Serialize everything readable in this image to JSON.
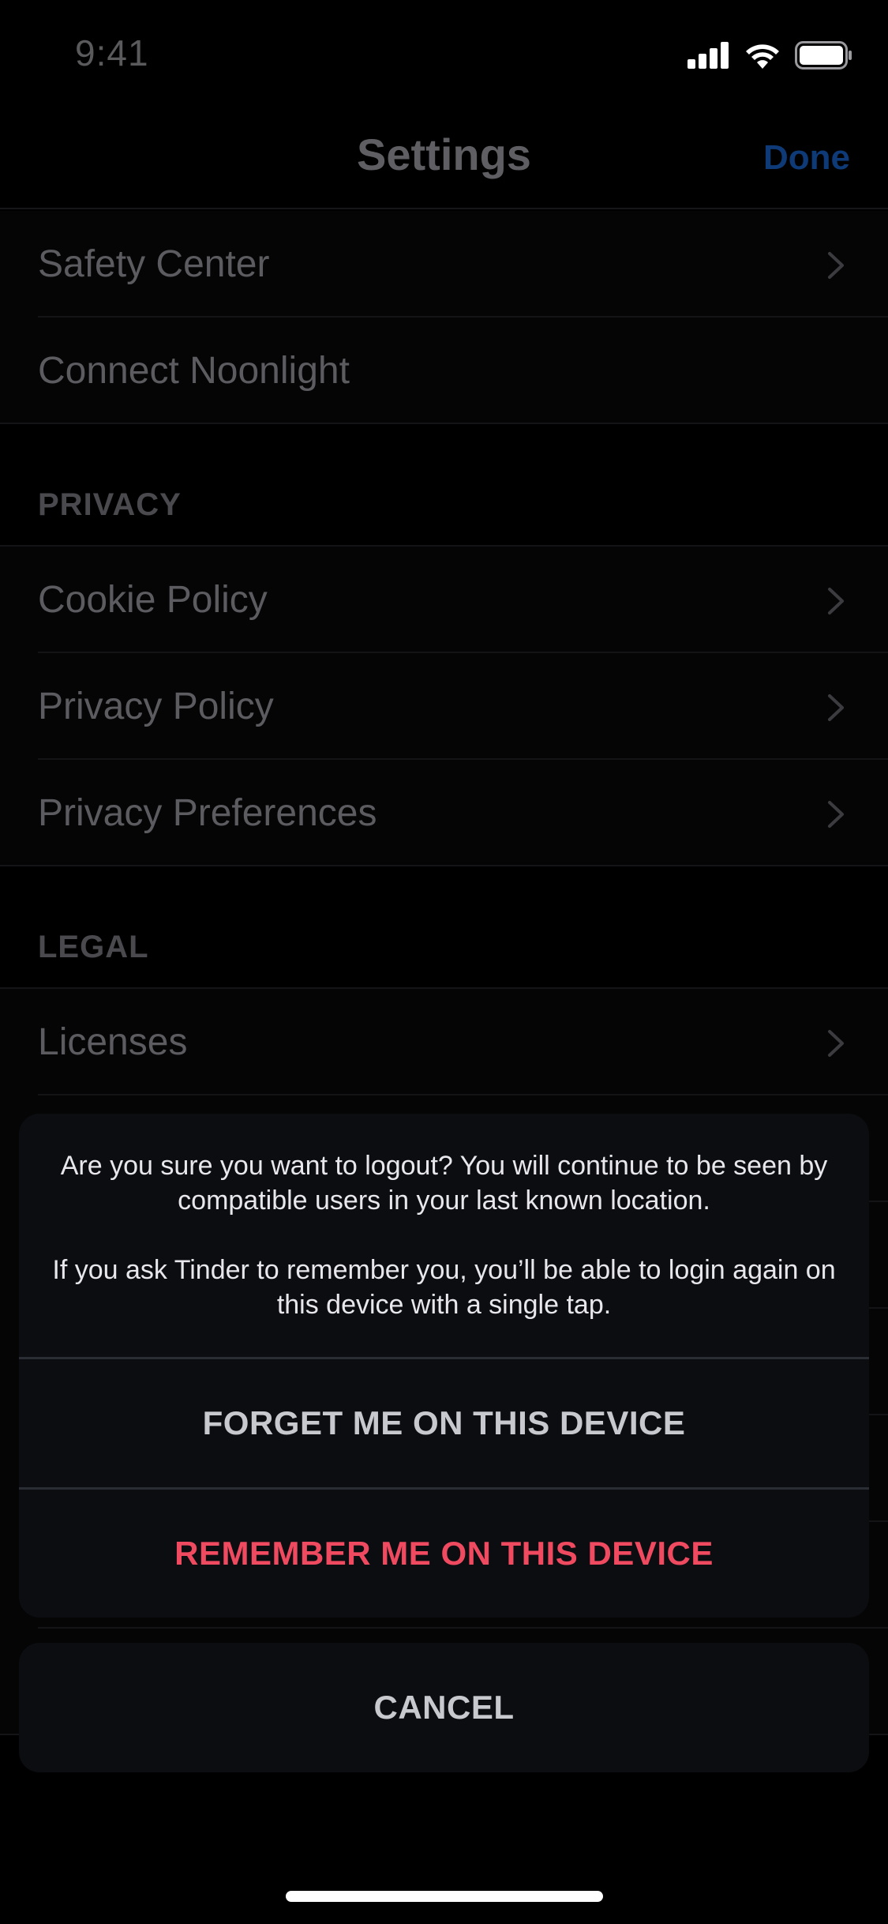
{
  "status_bar": {
    "time": "9:41"
  },
  "nav": {
    "title": "Settings",
    "done_label": "Done"
  },
  "settings": {
    "safety_center": "Safety Center",
    "connect_noonlight": "Connect Noonlight",
    "privacy_header": "PRIVACY",
    "cookie_policy": "Cookie Policy",
    "privacy_policy": "Privacy Policy",
    "privacy_preferences": "Privacy Preferences",
    "legal_header": "LEGAL",
    "licenses": "Licenses"
  },
  "action_sheet": {
    "message_line1": "Are you sure you want to logout? You will continue to be seen by compatible users in your last known location.",
    "message_line2": "If you ask Tinder to remember you, you’ll be able to login again on this device with a single tap.",
    "forget_label": "FORGET ME ON THIS DEVICE",
    "remember_label": "REMEMBER ME ON THIS DEVICE",
    "cancel_label": "CANCEL"
  },
  "colors": {
    "accent_done": "#0e3a77",
    "remember_red": "#ef4a5f",
    "sheet_bg": "#0c0d11"
  },
  "icons": [
    "signal-icon",
    "wifi-icon",
    "battery-icon",
    "chevron-right-icon"
  ]
}
